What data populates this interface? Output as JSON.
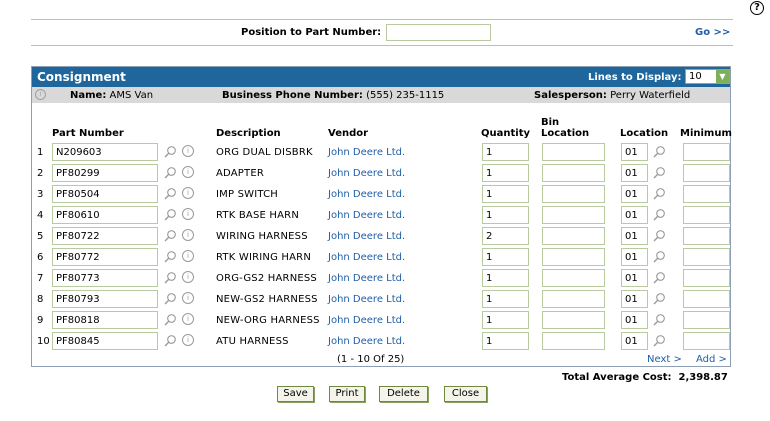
{
  "help": {
    "symbol": "?"
  },
  "position": {
    "label": "Position to Part Number:",
    "value": "",
    "go_label": "Go >>"
  },
  "panel": {
    "title": "Consignment",
    "lines_label": "Lines to Display:",
    "lines_value": "10"
  },
  "info": {
    "name_label": "Name:",
    "name_value": "AMS Van",
    "phone_label": "Business Phone Number:",
    "phone_value": "(555) 235-1115",
    "sales_label": "Salesperson:",
    "sales_value": "Perry Waterfield"
  },
  "columns": {
    "part": "Part Number",
    "desc": "Description",
    "vendor": "Vendor",
    "qty": "Quantity",
    "bin1": "Bin",
    "bin2": "Location",
    "loc": "Location",
    "min": "Minimum"
  },
  "rows": [
    {
      "n": "1",
      "part": "N209603",
      "desc": "ORG DUAL DISBRK",
      "vendor": "John Deere Ltd.",
      "qty": "1",
      "bin": "",
      "loc": "01",
      "min": ""
    },
    {
      "n": "2",
      "part": "PF80299",
      "desc": "ADAPTER",
      "vendor": "John Deere Ltd.",
      "qty": "1",
      "bin": "",
      "loc": "01",
      "min": ""
    },
    {
      "n": "3",
      "part": "PF80504",
      "desc": "IMP SWITCH",
      "vendor": "John Deere Ltd.",
      "qty": "1",
      "bin": "",
      "loc": "01",
      "min": ""
    },
    {
      "n": "4",
      "part": "PF80610",
      "desc": "RTK BASE HARN",
      "vendor": "John Deere Ltd.",
      "qty": "1",
      "bin": "",
      "loc": "01",
      "min": ""
    },
    {
      "n": "5",
      "part": "PF80722",
      "desc": "WIRING HARNESS",
      "vendor": "John Deere Ltd.",
      "qty": "2",
      "bin": "",
      "loc": "01",
      "min": ""
    },
    {
      "n": "6",
      "part": "PF80772",
      "desc": "RTK WIRING HARN",
      "vendor": "John Deere Ltd.",
      "qty": "1",
      "bin": "",
      "loc": "01",
      "min": ""
    },
    {
      "n": "7",
      "part": "PF80773",
      "desc": "ORG-GS2 HARNESS",
      "vendor": "John Deere Ltd.",
      "qty": "1",
      "bin": "",
      "loc": "01",
      "min": ""
    },
    {
      "n": "8",
      "part": "PF80793",
      "desc": "NEW-GS2 HARNESS",
      "vendor": "John Deere Ltd.",
      "qty": "1",
      "bin": "",
      "loc": "01",
      "min": ""
    },
    {
      "n": "9",
      "part": "PF80818",
      "desc": "NEW-ORG HARNESS",
      "vendor": "John Deere Ltd.",
      "qty": "1",
      "bin": "",
      "loc": "01",
      "min": ""
    },
    {
      "n": "10",
      "part": "PF80845",
      "desc": "ATU HARNESS",
      "vendor": "John Deere Ltd.",
      "qty": "1",
      "bin": "",
      "loc": "01",
      "min": ""
    }
  ],
  "pager": {
    "text": "(1 - 10 Of 25)",
    "next": "Next >",
    "add": "Add >"
  },
  "total": {
    "label": "Total Average Cost:",
    "value": "2,398.87"
  },
  "buttons": {
    "save": "Save",
    "print": "Print",
    "delete": "Delete",
    "close": "Close"
  },
  "colors": {
    "header": "#1f669c",
    "link": "#1f5fa8",
    "input_border": "#b9c9a0"
  }
}
